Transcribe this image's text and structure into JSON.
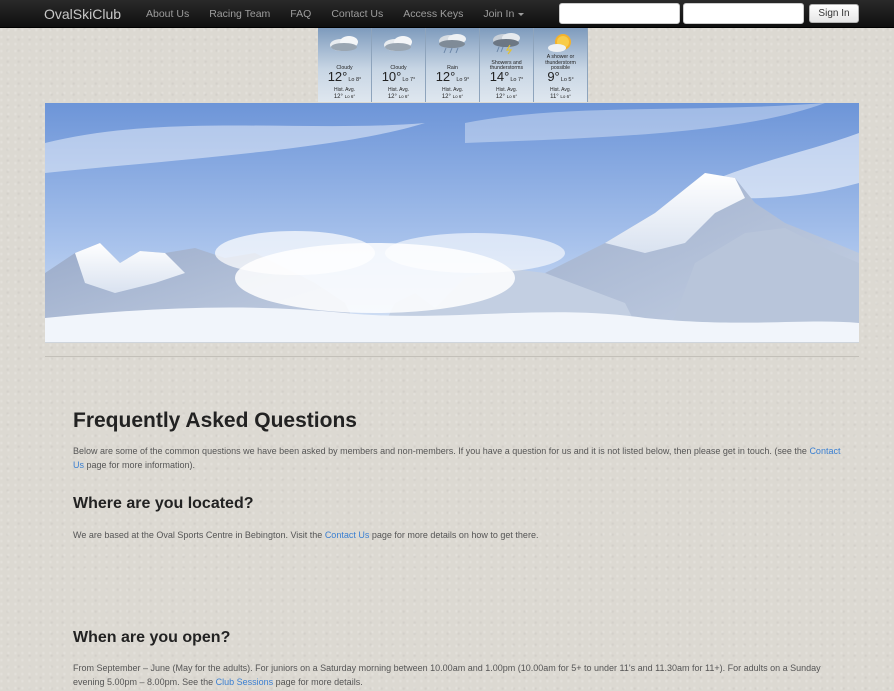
{
  "nav": {
    "brand": "OvalSkiClub",
    "links": [
      "About Us",
      "Racing Team",
      "FAQ",
      "Contact Us",
      "Access Keys"
    ],
    "join_label": "Join In",
    "username_value": "",
    "password_value": "",
    "signin_label": "Sign In"
  },
  "weather": [
    {
      "icon": "cloudy-icon",
      "condition": "Cloudy",
      "hi": "12°",
      "lo": "Lo 8°",
      "hist_label": "Hist. Avg.",
      "hist_hi": "12°",
      "hist_lo": "Lo 6°"
    },
    {
      "icon": "cloudy-icon",
      "condition": "Cloudy",
      "hi": "10°",
      "lo": "Lo 7°",
      "hist_label": "Hist. Avg.",
      "hist_hi": "12°",
      "hist_lo": "Lo 6°"
    },
    {
      "icon": "rain-icon",
      "condition": "Rain",
      "hi": "12°",
      "lo": "Lo 9°",
      "hist_label": "Hist. Avg.",
      "hist_hi": "12°",
      "hist_lo": "Lo 6°"
    },
    {
      "icon": "thunderstorm-icon",
      "condition": "Showers and thunderstorms",
      "hi": "14°",
      "lo": "Lo 7°",
      "hist_label": "Hist. Avg.",
      "hist_hi": "12°",
      "hist_lo": "Lo 6°"
    },
    {
      "icon": "sun-shower-icon",
      "condition": "A shower or thunderstorm possible",
      "hi": "9°",
      "lo": "Lo 5°",
      "hist_label": "Hist. Avg.",
      "hist_hi": "11°",
      "hist_lo": "Lo 6°"
    }
  ],
  "faq": {
    "title": "Frequently Asked Questions",
    "intro_text": "Below are some of the common questions we have been asked by members and non-members. If you have a question for us and it is not listed below, then please get in touch. (see the ",
    "intro_link": "Contact Us",
    "intro_end": " page for more information).",
    "q1": {
      "question": "Where are you located?",
      "answer_pre": "We are based at the Oval Sports Centre in Bebington. Visit the ",
      "answer_link": "Contact Us",
      "answer_post": " page for more details on how to get there."
    },
    "q2": {
      "question": "When are you open?",
      "answer_pre": "From September – June (May for the adults). For juniors on a Saturday morning between 10.00am and 1.00pm (10.00am for 5+ to under 11's and 11.30am for 11+). For adults on a Sunday evening 5.00pm – 8.00pm. See the ",
      "answer_link": "Club Sessions",
      "answer_post": " page for more details."
    }
  },
  "colors": {
    "navbar": "#111111",
    "link": "#3a7fd1",
    "background": "#dcd9d2"
  }
}
